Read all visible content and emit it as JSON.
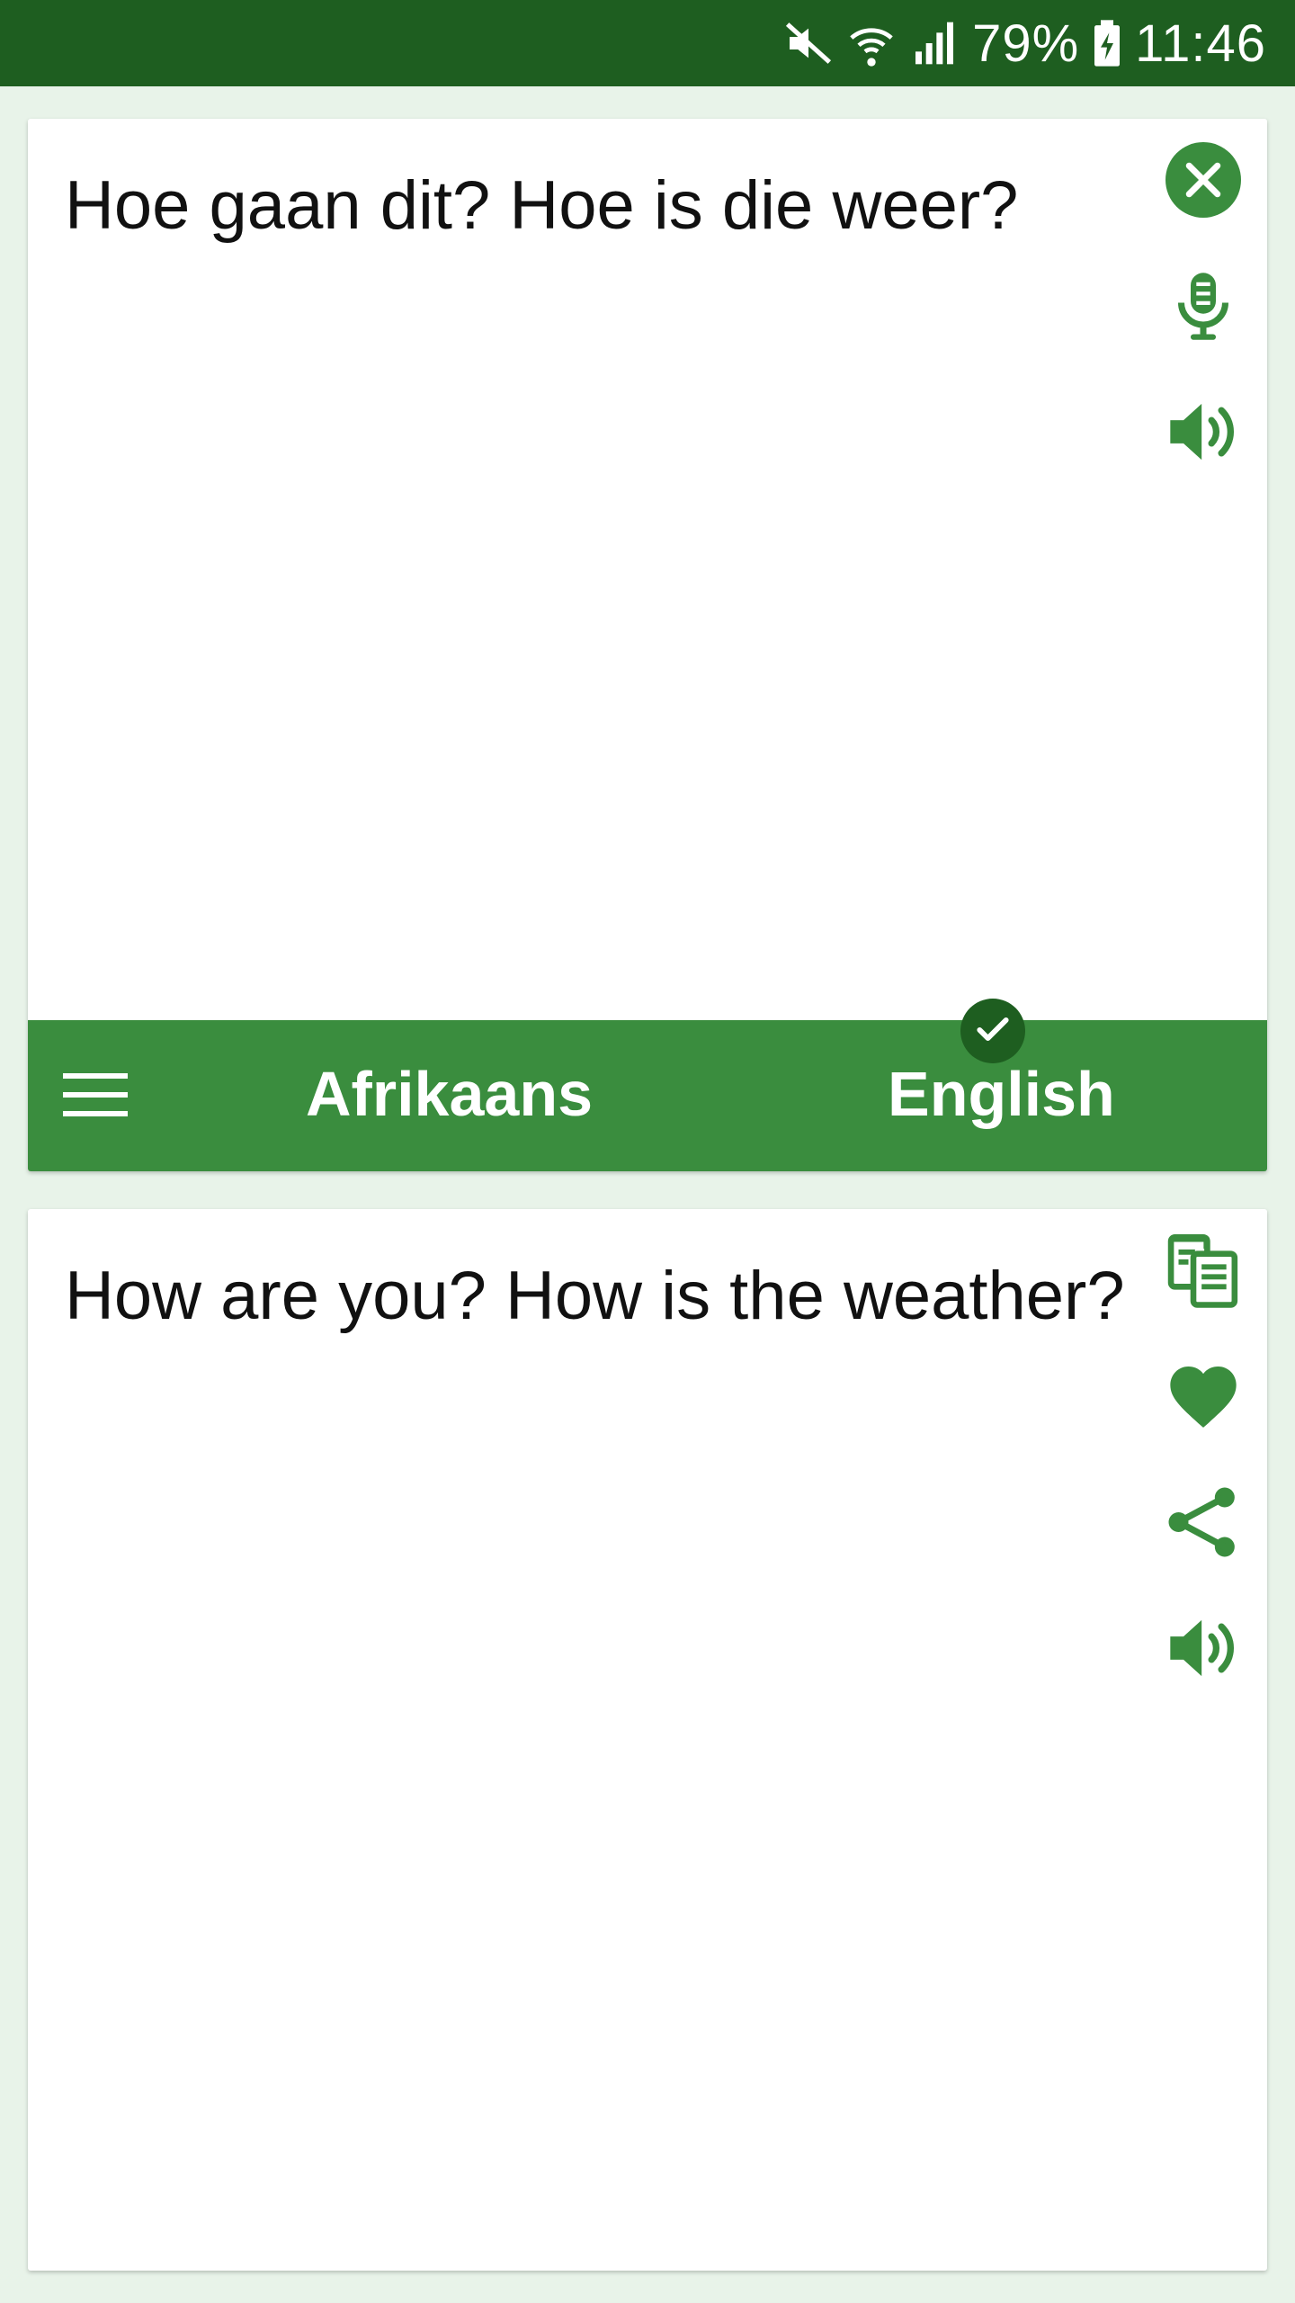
{
  "status_bar": {
    "battery_percent": "79%",
    "time": "11:46",
    "icons": [
      "mute-icon",
      "wifi-icon",
      "signal-icon",
      "battery-charging-icon"
    ]
  },
  "source": {
    "text": "Hoe gaan dit? Hoe is die weer?",
    "actions": [
      "clear-icon",
      "microphone-icon",
      "speaker-icon"
    ]
  },
  "language_bar": {
    "menu_icon": "menu-icon",
    "source_language": "Afrikaans",
    "target_language": "English",
    "selected_indicator": "check-icon"
  },
  "target": {
    "text": "How are you? How is the weather?",
    "actions": [
      "copy-icon",
      "favorite-icon",
      "share-icon",
      "speaker-icon"
    ]
  },
  "colors": {
    "status_bar": "#1e5e20",
    "accent": "#3a8d3e",
    "background": "#e8f3e9",
    "icon": "#3a8d3e"
  }
}
